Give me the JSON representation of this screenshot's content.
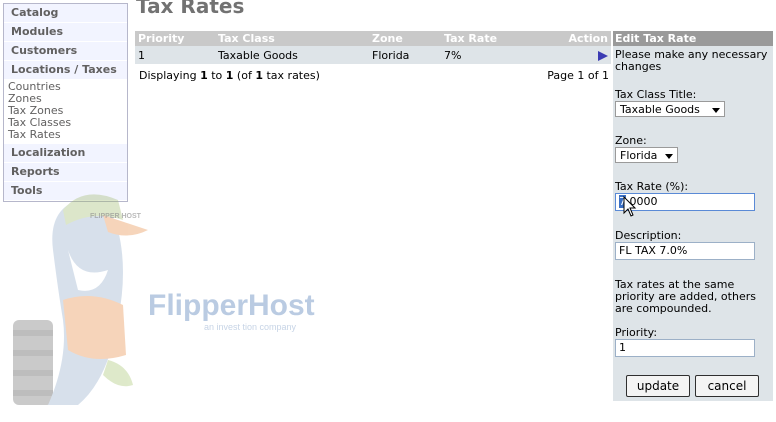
{
  "sidebar": {
    "catalog": "Catalog",
    "modules": "Modules",
    "customers": "Customers",
    "locations": "Locations / Taxes",
    "sub_items": [
      "Countries",
      "Zones",
      "Tax Zones",
      "Tax Classes",
      "Tax Rates"
    ],
    "localization": "Localization",
    "reports": "Reports",
    "tools": "Tools"
  },
  "logo": {
    "brand": "FlipperHost",
    "tagline": "an invest tion company",
    "cap_text": "FLIPPER HOST"
  },
  "page_title": "Tax Rates",
  "table": {
    "headers": {
      "priority": "Priority",
      "tax_class": "Tax Class",
      "zone": "Zone",
      "tax_rate": "Tax Rate",
      "action": "Action"
    },
    "rows": [
      {
        "priority": "1",
        "tax_class": "Taxable Goods",
        "zone": "Florida",
        "tax_rate": "7%"
      }
    ]
  },
  "paging": {
    "prefix": "Displaying",
    "from": "1",
    "to_word": "to",
    "to": "1",
    "of_open": "(of",
    "total": "1",
    "suffix": "tax rates)",
    "page_text": "Page 1 of 1"
  },
  "edit": {
    "title": "Edit Tax Rate",
    "intro": "Please make any necessary changes",
    "tax_class_label": "Tax Class Title:",
    "tax_class_value": "Taxable Goods",
    "zone_label": "Zone:",
    "zone_value": "Florida",
    "rate_label": "Tax Rate (%):",
    "rate_value_selected": "7",
    "rate_value_rest": ".0000",
    "desc_label": "Description:",
    "desc_value": "FL TAX 7.0%",
    "note": "Tax rates at the same priority are added, others are compounded.",
    "priority_label": "Priority:",
    "priority_value": "1",
    "update_label": "update",
    "cancel_label": "cancel"
  },
  "colors": {
    "header_bg": "#c9c9c9",
    "row_bg": "#dee4e8",
    "panel_bg": "#dee4e8",
    "sidebar_head_bg": "#f2f4ff",
    "accent_arrow": "#3b3bb3"
  }
}
